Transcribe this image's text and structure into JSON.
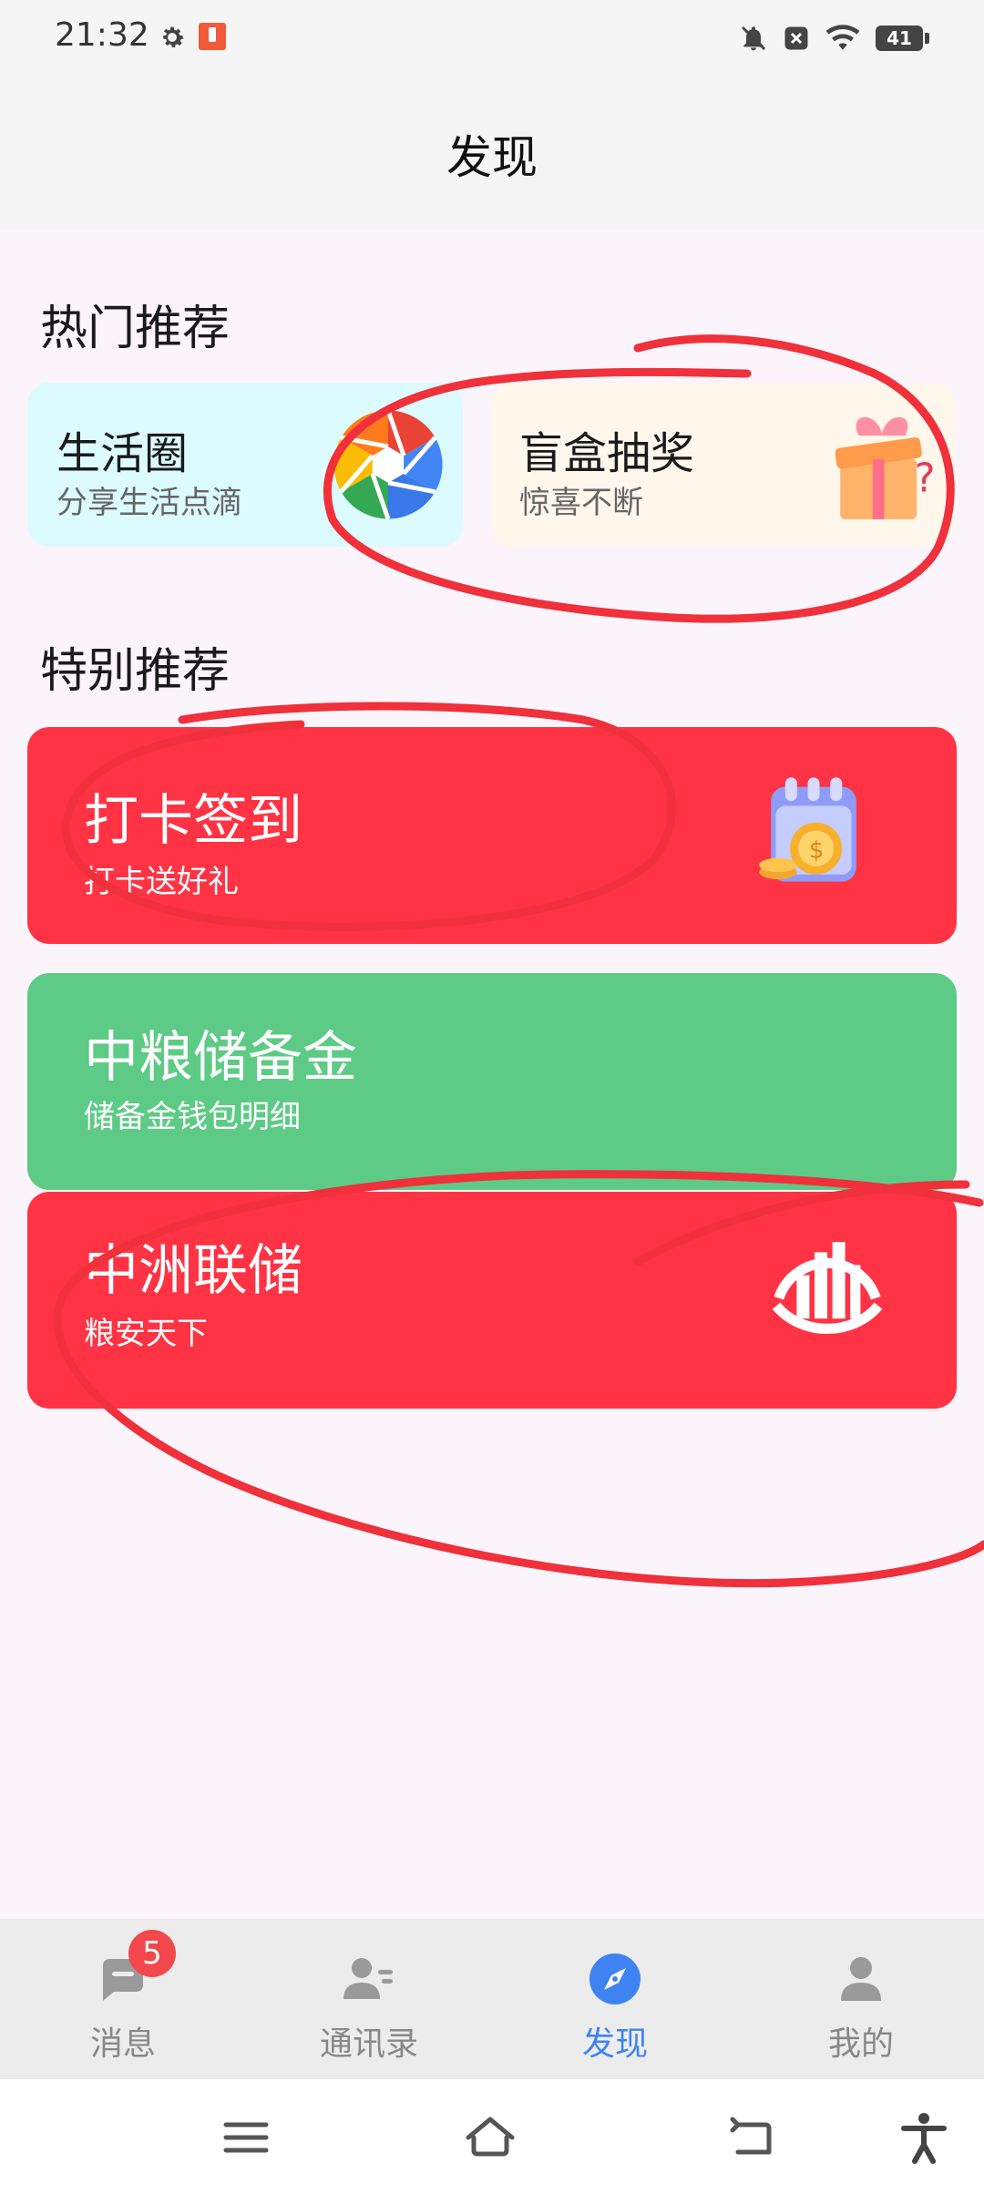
{
  "status": {
    "time": "21:32",
    "battery": "41"
  },
  "header": {
    "title": "发现"
  },
  "sections": {
    "hot": "热门推荐",
    "special": "特别推荐"
  },
  "hot_cards": [
    {
      "title": "生活圈",
      "subtitle": "分享生活点滴",
      "icon": "aperture-icon"
    },
    {
      "title": "盲盒抽奖",
      "subtitle": "惊喜不断",
      "icon": "gift-box-icon"
    }
  ],
  "special_cards": [
    {
      "title": "打卡签到",
      "subtitle": "打卡送好礼",
      "color": "#ff3344",
      "icon": "calendar-coin-icon"
    },
    {
      "title": "中粮储备金",
      "subtitle": "储备金钱包明细",
      "color": "#5dcb85"
    },
    {
      "title": "中洲联储",
      "subtitle": "粮安天下",
      "color": "#ff3344",
      "icon": "building-logo-icon"
    }
  ],
  "tabs": [
    {
      "label": "消息",
      "icon": "message-icon",
      "badge": "5",
      "active": false
    },
    {
      "label": "通讯录",
      "icon": "contacts-icon",
      "active": false
    },
    {
      "label": "发现",
      "icon": "compass-icon",
      "active": true
    },
    {
      "label": "我的",
      "icon": "profile-icon",
      "active": false
    }
  ],
  "colors": {
    "accent": "#3e83f1",
    "annotation": "#f0303a"
  }
}
